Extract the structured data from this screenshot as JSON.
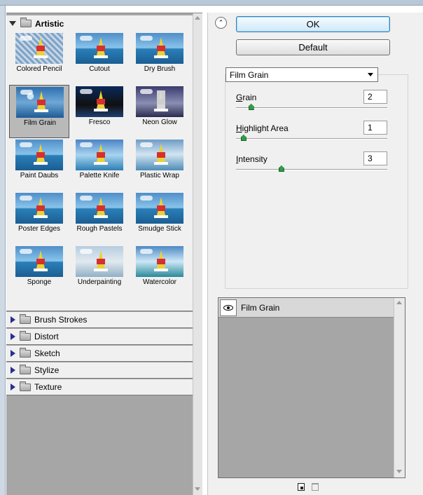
{
  "gallery": {
    "open_category": "Artistic",
    "filters": [
      {
        "name": "Colored Pencil",
        "cls": "t-pencil"
      },
      {
        "name": "Cutout",
        "cls": "t-cutout"
      },
      {
        "name": "Dry Brush",
        "cls": "t-dry"
      },
      {
        "name": "Film Grain",
        "cls": "t-film",
        "selected": true
      },
      {
        "name": "Fresco",
        "cls": "t-fresco"
      },
      {
        "name": "Neon Glow",
        "cls": "t-neon"
      },
      {
        "name": "Paint Daubs",
        "cls": "t-daubs"
      },
      {
        "name": "Palette Knife",
        "cls": "t-palette"
      },
      {
        "name": "Plastic Wrap",
        "cls": "t-plastic"
      },
      {
        "name": "Poster Edges",
        "cls": "t-poster"
      },
      {
        "name": "Rough Pastels",
        "cls": "t-rough"
      },
      {
        "name": "Smudge Stick",
        "cls": "t-smudge"
      },
      {
        "name": "Sponge",
        "cls": "t-sponge"
      },
      {
        "name": "Underpainting",
        "cls": "t-under"
      },
      {
        "name": "Watercolor",
        "cls": "t-water"
      }
    ],
    "categories": [
      "Brush Strokes",
      "Distort",
      "Sketch",
      "Stylize",
      "Texture"
    ]
  },
  "buttons": {
    "ok": "OK",
    "default": "Default"
  },
  "settings": {
    "filter_select": "Film Grain",
    "params": [
      {
        "label_underline": "G",
        "label_rest": "rain",
        "value": "2",
        "level": 0.1
      },
      {
        "label_underline": "H",
        "label_rest": "ighlight Area",
        "value": "1",
        "level": 0.05
      },
      {
        "label_underline": "I",
        "label_rest": "ntensity",
        "value": "3",
        "level": 0.3
      }
    ]
  },
  "layers": {
    "items": [
      "Film Grain"
    ]
  }
}
